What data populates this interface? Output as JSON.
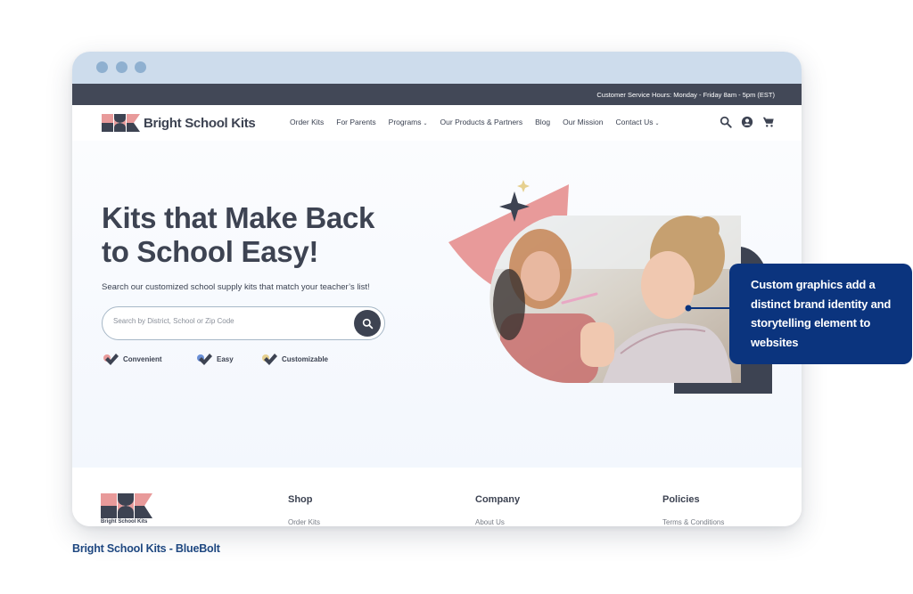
{
  "topbar": {
    "hours": "Customer Service Hours: Monday - Friday 8am - 5pm (EST)"
  },
  "brand": {
    "name": "Bright School Kits",
    "colors": {
      "pink": "#e89a9a",
      "navy": "#3d4352",
      "callout": "#0b347e"
    }
  },
  "nav": {
    "items": [
      {
        "label": "Order Kits",
        "dropdown": false
      },
      {
        "label": "For Parents",
        "dropdown": false
      },
      {
        "label": "Programs",
        "dropdown": true
      },
      {
        "label": "Our Products & Partners",
        "dropdown": false
      },
      {
        "label": "Blog",
        "dropdown": false
      },
      {
        "label": "Our Mission",
        "dropdown": false
      },
      {
        "label": "Contact Us",
        "dropdown": true
      }
    ],
    "chevron": "⌄",
    "icons": [
      "search-icon",
      "account-icon",
      "cart-icon"
    ]
  },
  "hero": {
    "headline_line1": "Kits that Make Back",
    "headline_line2_pre": "to School ",
    "headline_emphasis": "Easy",
    "headline_end": "!",
    "subtitle": "Search our customized school supply kits that match your teacher’s list!",
    "search_placeholder": "Search by District, School or Zip Code",
    "features": [
      {
        "label": "Convenient",
        "color": "#e89a9a"
      },
      {
        "label": "Easy",
        "color": "#6a8fd6"
      },
      {
        "label": "Customizable",
        "color": "#e6d08f"
      }
    ]
  },
  "footer": {
    "logo_text": "Bright School Kits",
    "columns": [
      {
        "heading": "Shop",
        "first_link": "Order Kits"
      },
      {
        "heading": "Company",
        "first_link": "About Us"
      },
      {
        "heading": "Policies",
        "first_link": "Terms & Conditions"
      }
    ]
  },
  "callout": {
    "text": "Custom graphics  add a distinct brand identity and storytelling element to websites"
  },
  "caption": "Bright School Kits -  BlueBolt"
}
